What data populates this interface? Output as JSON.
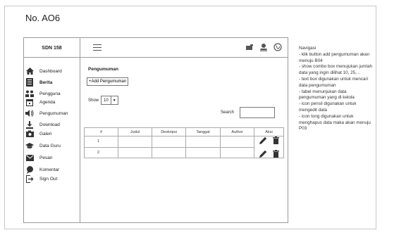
{
  "doc_id": "No. AO6",
  "app": {
    "brand": "SDN 158",
    "top_icons": [
      "mail-icon",
      "user-icon",
      "globe-icon"
    ]
  },
  "sidebar": {
    "items": [
      {
        "label": "Dashboard",
        "icon": "home-icon"
      },
      {
        "label": "Berita",
        "icon": "news-icon",
        "active": true
      },
      {
        "label": "Pengguna",
        "icon": "users-icon"
      },
      {
        "label": "Agenda",
        "icon": "calendar-icon"
      },
      {
        "label": "Pengumuman",
        "icon": "speaker-icon"
      },
      {
        "label": "Download",
        "icon": "download-icon"
      },
      {
        "label": "Galeri",
        "icon": "camera-icon"
      },
      {
        "label": "Data Guru",
        "icon": "graduation-cap-icon"
      },
      {
        "label": "Pesan",
        "icon": "mail-icon"
      },
      {
        "label": "Komentar",
        "icon": "comment-icon"
      },
      {
        "label": "Sign Out",
        "icon": "sign-out-icon"
      }
    ]
  },
  "main": {
    "title": "Pengumuman",
    "add_button": "+Add Pengumuman",
    "show_label": "Show",
    "show_value": "10",
    "search_label": "Search",
    "search_value": "",
    "table": {
      "columns": [
        "#",
        "Judul",
        "Deskripsi",
        "Tanggal",
        "Author",
        "Aksi"
      ],
      "rows": [
        {
          "no": "1",
          "judul": "",
          "deskripsi": "",
          "tanggal": "",
          "author": ""
        },
        {
          "no": "2",
          "judul": "",
          "deskripsi": "",
          "tanggal": "",
          "author": ""
        }
      ]
    }
  },
  "notes": [
    "Navigasi",
    "- klik  button add pengumuman akan menuju B04",
    "- show combo box menujukan jumlah data yang ingin dilihat 10, 25, ..",
    "- text box digunakan untuk mencari data pengumuman",
    "- tabel menunjukan data pengumuman yang di kelola",
    "- icon pensil digunakan untuk mengedit data",
    "- icon tong digunakan untuk menghapus data maka akan menuju P03"
  ]
}
